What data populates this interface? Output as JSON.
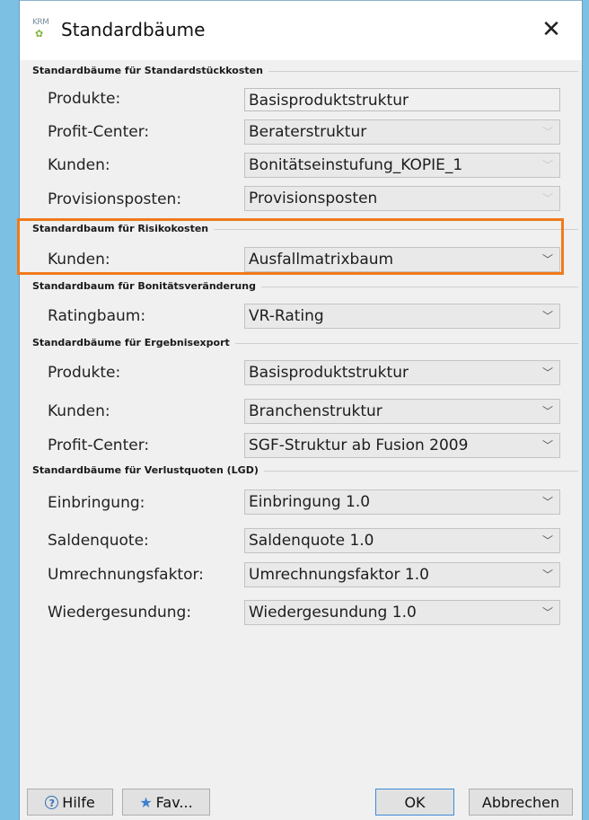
{
  "window": {
    "icon_text": "KRM",
    "title": "Standardbäume",
    "close_glyph": "✕"
  },
  "sections": [
    {
      "header": "Standardbäume für Standardstückkosten",
      "rows": [
        {
          "label": "Produkte:",
          "value": "Basisproduktstruktur",
          "kind": "text"
        },
        {
          "label": "Profit-Center:",
          "value": "Beraterstruktur",
          "kind": "disabled"
        },
        {
          "label": "Kunden:",
          "value": "Bonitätseinstufung_KOPIE_1",
          "kind": "disabled"
        },
        {
          "label": "Provisionsposten:",
          "value": "Provisionsposten",
          "kind": "disabled"
        }
      ]
    },
    {
      "header": "Standardbaum für Risikokosten",
      "rows": [
        {
          "label": "Kunden:",
          "value": "Ausfallmatrixbaum",
          "kind": "select"
        }
      ]
    },
    {
      "header": "Standardbaum für Bonitätsveränderung",
      "rows": [
        {
          "label": "Ratingbaum:",
          "value": "VR-Rating",
          "kind": "select"
        }
      ]
    },
    {
      "header": "Standardbäume für Ergebnisexport",
      "rows": [
        {
          "label": "Produkte:",
          "value": "Basisproduktstruktur",
          "kind": "select"
        },
        {
          "label": "Kunden:",
          "value": "Branchenstruktur",
          "kind": "select"
        },
        {
          "label": "Profit-Center:",
          "value": "SGF-Struktur ab Fusion 2009",
          "kind": "select"
        }
      ]
    },
    {
      "header": "Standardbäume für Verlustquoten (LGD)",
      "rows": [
        {
          "label": "Einbringung:",
          "value": "Einbringung 1.0",
          "kind": "select"
        },
        {
          "label": "Saldenquote:",
          "value": "Saldenquote 1.0",
          "kind": "select"
        },
        {
          "label": "Umrechnungsfaktor:",
          "value": "Umrechnungsfaktor 1.0",
          "kind": "select"
        },
        {
          "label": "Wiedergesundung:",
          "value": "Wiedergesundung 1.0",
          "kind": "select"
        }
      ]
    }
  ],
  "footer": {
    "help_label": "Hilfe",
    "fav_label": "Fav...",
    "ok_label": "OK",
    "cancel_label": "Abbrechen"
  },
  "colors": {
    "highlight": "#f07a1c",
    "background": "#7cc1e4"
  }
}
